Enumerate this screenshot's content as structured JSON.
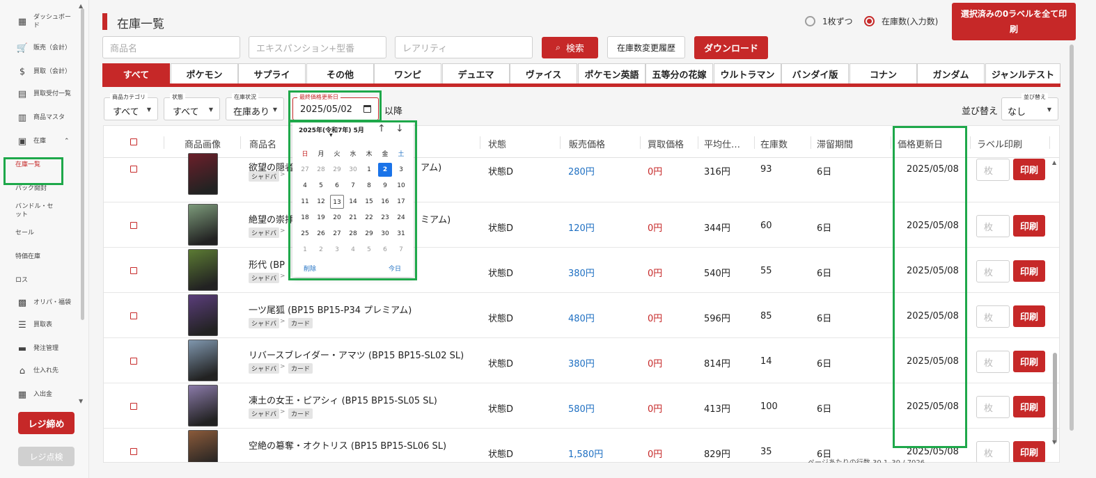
{
  "sidebar": {
    "items": [
      {
        "label": "ダッシュボード",
        "icon": "dashboard-icon",
        "glyph": "▦"
      },
      {
        "label": "販売（会計）",
        "icon": "cart-icon",
        "glyph": "🛒"
      },
      {
        "label": "買取（会計）",
        "icon": "dollar-circle-icon",
        "glyph": "$"
      },
      {
        "label": "買取受付一覧",
        "icon": "clipboard-icon",
        "glyph": "▤"
      },
      {
        "label": "商品マスタ",
        "icon": "store-icon",
        "glyph": "▥"
      },
      {
        "label": "在庫",
        "icon": "inventory-box-icon",
        "glyph": "▣"
      },
      {
        "label": "在庫一覧"
      },
      {
        "label": "パック開封"
      },
      {
        "label": "バンドル・セット"
      },
      {
        "label": "セール"
      },
      {
        "label": "特価在庫"
      },
      {
        "label": "ロス"
      },
      {
        "label": "オリパ・福袋",
        "icon": "gift-icon",
        "glyph": "▩"
      },
      {
        "label": "買取表",
        "icon": "list-icon",
        "glyph": "☰"
      },
      {
        "label": "発注管理",
        "icon": "truck-icon",
        "glyph": "▬"
      },
      {
        "label": "仕入れ先",
        "icon": "building-icon",
        "glyph": "⌂"
      },
      {
        "label": "入出金",
        "icon": "safe-icon",
        "glyph": "▦"
      }
    ],
    "close_register": "レジ締め",
    "check_register": "レジ点検"
  },
  "header": {
    "title": "在庫一覧",
    "radio_single": "1枚ずつ",
    "radio_qty": "在庫数(入力数)",
    "print_all": "選択済みの0ラベルを全て印刷"
  },
  "search": {
    "name_placeholder": "商品名",
    "expansion_placeholder": "エキスパンション+型番",
    "rarity_placeholder": "レアリティ",
    "search_label": "検索",
    "history_label": "在庫数変更履歴",
    "download_label": "ダウンロード"
  },
  "tabs": [
    "すべて",
    "ポケモン",
    "サプライ",
    "その他",
    "ワンピ",
    "デュエマ",
    "ヴァイス",
    "ポケモン英語",
    "五等分の花嫁",
    "ウルトラマン",
    "バンダイ版",
    "コナン",
    "ガンダム",
    "ジャンルテスト"
  ],
  "filters": {
    "category": {
      "label": "商品カテゴリ",
      "value": "すべて"
    },
    "condition": {
      "label": "状態",
      "value": "すべて"
    },
    "stock": {
      "label": "在庫状況",
      "value": "在庫あり"
    },
    "date": {
      "label": "最終価格更新日",
      "value": "2025/05/02"
    },
    "after": "以降",
    "sort_text": "並び替え",
    "sort": {
      "label": "並び替え",
      "value": "なし"
    }
  },
  "table": {
    "headers": [
      "商品画像",
      "商品名",
      "状態",
      "販売価格",
      "買取価格",
      "平均仕…",
      "在庫数",
      "滞留期間",
      "価格更新日",
      "ラベル印刷"
    ],
    "rows": [
      {
        "name": "欲望の隠者",
        "name_tail": "アム)",
        "tags": [
          "シャドバ"
        ],
        "state": "状態D",
        "sell": "280円",
        "buy": "0円",
        "avg": "316円",
        "qty": "93",
        "stay": "6日",
        "date": "2025/05/08",
        "card_color": "#6b1f2a"
      },
      {
        "name": "絶望の崇拝",
        "name_tail": "ミアム)",
        "tags": [
          "シャドバ"
        ],
        "state": "状態D",
        "sell": "120円",
        "buy": "0円",
        "avg": "344円",
        "qty": "60",
        "stay": "6日",
        "date": "2025/05/08",
        "card_color": "#7c9a7a"
      },
      {
        "name": "形代 (BP",
        "name_tail": "",
        "tags": [
          "シャドバ"
        ],
        "state": "状態D",
        "sell": "380円",
        "buy": "0円",
        "avg": "540円",
        "qty": "55",
        "stay": "6日",
        "date": "2025/05/08",
        "card_color": "#5b7a33"
      },
      {
        "name": "一ツ尾狐 (BP15 BP15-P34 プレミアム)",
        "name_tail": "",
        "tags": [
          "シャドバ",
          "カード"
        ],
        "state": "状態D",
        "sell": "480円",
        "buy": "0円",
        "avg": "596円",
        "qty": "85",
        "stay": "6日",
        "date": "2025/05/08",
        "card_color": "#5a3d7a"
      },
      {
        "name": "リバースブレイダー・アマツ (BP15 BP15-SL02 SL)",
        "name_tail": "",
        "tags": [
          "シャドバ",
          "カード"
        ],
        "state": "状態D",
        "sell": "380円",
        "buy": "0円",
        "avg": "814円",
        "qty": "14",
        "stay": "6日",
        "date": "2025/05/08",
        "card_color": "#7f96ad"
      },
      {
        "name": "凍土の女王・ピアシィ (BP15 BP15-SL05 SL)",
        "name_tail": "",
        "tags": [
          "シャドバ",
          "カード"
        ],
        "state": "状態D",
        "sell": "580円",
        "buy": "0円",
        "avg": "413円",
        "qty": "100",
        "stay": "6日",
        "date": "2025/05/08",
        "card_color": "#8a7aa8"
      },
      {
        "name": "空絶の簒奪・オクトリス (BP15 BP15-SL06 SL)",
        "name_tail": "",
        "tags": [],
        "state": "状態D",
        "sell": "1,580円",
        "buy": "0円",
        "avg": "829円",
        "qty": "35",
        "stay": "6日",
        "date": "2025/05/08",
        "card_color": "#8a5a3a"
      }
    ],
    "qty_placeholder": "枚",
    "print_label": "印刷",
    "footer": "ページあたりの行数 30   1–30 / 7026"
  },
  "datepicker": {
    "month_label": "2025年(令和7年) 5月",
    "weekdays": [
      "日",
      "月",
      "火",
      "水",
      "木",
      "金",
      "土"
    ],
    "days": [
      [
        "27",
        "28",
        "29",
        "30",
        "1",
        "2",
        "3"
      ],
      [
        "4",
        "5",
        "6",
        "7",
        "8",
        "9",
        "10"
      ],
      [
        "11",
        "12",
        "13",
        "14",
        "15",
        "16",
        "17"
      ],
      [
        "18",
        "19",
        "20",
        "21",
        "22",
        "23",
        "24"
      ],
      [
        "25",
        "26",
        "27",
        "28",
        "29",
        "30",
        "31"
      ],
      [
        "1",
        "2",
        "3",
        "4",
        "5",
        "6",
        "7"
      ]
    ],
    "selected": "2",
    "today": "13",
    "clear_label": "削除",
    "today_label": "今日"
  },
  "colors": {
    "accent": "#c62828",
    "highlight": "#1ea84a",
    "link": "#1e6fc2"
  }
}
